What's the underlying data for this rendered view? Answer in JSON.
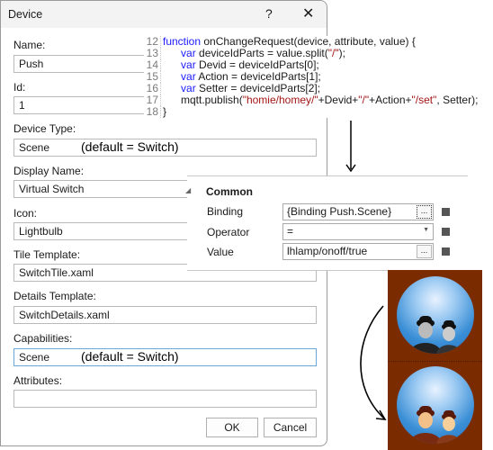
{
  "dialog": {
    "title": "Device",
    "help_label": "?",
    "close_label": "✕",
    "fields": {
      "name": {
        "label": "Name:",
        "value": "Push"
      },
      "id": {
        "label": "Id:",
        "value": "1"
      },
      "device_type": {
        "label": "Device Type:",
        "value": "Scene",
        "note": "(default = Switch)"
      },
      "display_name": {
        "label": "Display Name:",
        "value": "Virtual Switch"
      },
      "icon": {
        "label": "Icon:",
        "value": "Lightbulb"
      },
      "tile_template": {
        "label": "Tile Template:",
        "value": "SwitchTile.xaml"
      },
      "details_template": {
        "label": "Details Template:",
        "value": "SwitchDetails.xaml"
      },
      "capabilities": {
        "label": "Capabilities:",
        "value": "Scene",
        "note": "(default = Switch)"
      },
      "attributes": {
        "label": "Attributes:",
        "value": ""
      }
    },
    "ok_label": "OK",
    "cancel_label": "Cancel"
  },
  "code": {
    "lines": [
      {
        "n": "12",
        "parts": [
          {
            "t": "kw",
            "v": "function"
          },
          {
            "t": "txt",
            "v": " onChangeRequest(device, attribute, value) {"
          }
        ]
      },
      {
        "n": "13",
        "parts": [
          {
            "t": "txt",
            "v": "      "
          },
          {
            "t": "kw",
            "v": "var"
          },
          {
            "t": "txt",
            "v": " deviceIdParts = value.split("
          },
          {
            "t": "str",
            "v": "\"/\""
          },
          {
            "t": "txt",
            "v": ");"
          }
        ]
      },
      {
        "n": "14",
        "parts": [
          {
            "t": "txt",
            "v": "      "
          },
          {
            "t": "kw",
            "v": "var"
          },
          {
            "t": "txt",
            "v": " Devid = deviceIdParts[0];"
          }
        ]
      },
      {
        "n": "15",
        "parts": [
          {
            "t": "txt",
            "v": "      "
          },
          {
            "t": "kw",
            "v": "var"
          },
          {
            "t": "txt",
            "v": " Action = deviceIdParts[1];"
          }
        ]
      },
      {
        "n": "16",
        "parts": [
          {
            "t": "txt",
            "v": "      "
          },
          {
            "t": "kw",
            "v": "var"
          },
          {
            "t": "txt",
            "v": " Setter = deviceIdParts[2];"
          }
        ]
      },
      {
        "n": "17",
        "parts": [
          {
            "t": "txt",
            "v": "      mqtt.publish("
          },
          {
            "t": "str",
            "v": "\"homie/homey/\""
          },
          {
            "t": "txt",
            "v": "+Devid+"
          },
          {
            "t": "str",
            "v": "\"/\""
          },
          {
            "t": "txt",
            "v": "+Action+"
          },
          {
            "t": "str",
            "v": "\"/set\""
          },
          {
            "t": "txt",
            "v": ", Setter);"
          }
        ]
      },
      {
        "n": "18",
        "parts": [
          {
            "t": "txt",
            "v": "}"
          }
        ]
      }
    ]
  },
  "properties": {
    "section": "Common",
    "binding": {
      "label": "Binding",
      "value": "{Binding Push.Scene}",
      "button": "..."
    },
    "operator": {
      "label": "Operator",
      "value": "="
    },
    "value": {
      "label": "Value",
      "value": "lhlamp/onoff/true",
      "button": "..."
    }
  },
  "images": {
    "top": "grayscale-portrait-button",
    "bottom": "color-portrait-button"
  }
}
